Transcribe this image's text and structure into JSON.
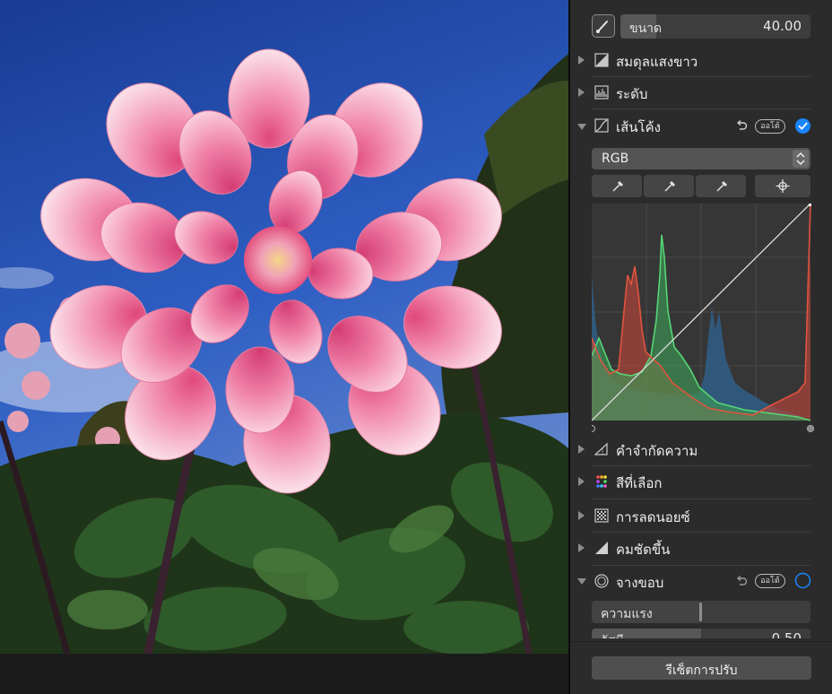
{
  "size_slider": {
    "label": "ขนาด",
    "value": "40.00"
  },
  "sections": {
    "white_balance": "สมดุลแสงขาว",
    "levels": "ระดับ",
    "curves": "เส้นโค้ง",
    "definition": "คำจำกัดความ",
    "selective_color": "สีที่เลือก",
    "noise_reduction": "การลดนอยซ์",
    "sharpen": "คมชัดขึ้น",
    "vignette": "จางขอบ"
  },
  "curves": {
    "auto_label": "ออโต้",
    "channel": "RGB"
  },
  "vignette": {
    "auto_label": "ออโต้",
    "intensity_label": "ความแรง",
    "radius_label": "รัศมี",
    "radius_value": "0.50"
  },
  "reset_label": "รีเซ็ตการปรับ",
  "colors": {
    "accent": "#1a84ff",
    "panel_bg": "#2b2b2b",
    "red_channel": "#d64a3a",
    "green_channel": "#4cc46a",
    "blue_channel": "#2d5f8f"
  }
}
